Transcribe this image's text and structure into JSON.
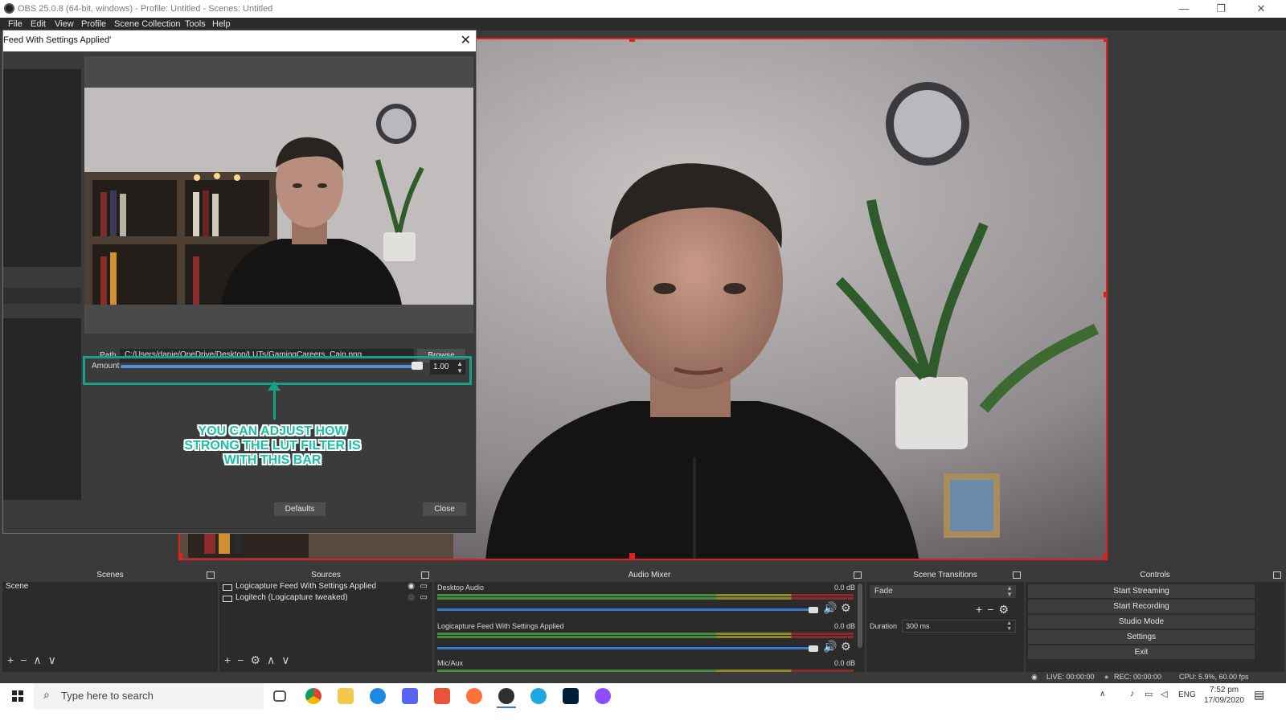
{
  "window": {
    "title": "OBS 25.0.8 (64-bit, windows) - Profile: Untitled - Scenes: Untitled",
    "controls": [
      "—",
      "❐",
      "✕"
    ]
  },
  "menu": [
    "File",
    "Edit",
    "View",
    "Profile",
    "Scene Collection",
    "Tools",
    "Help"
  ],
  "dialog": {
    "title": "Feed With Settings Applied'",
    "close_glyph": "✕",
    "path_label": "Path",
    "path_value": "C:/Users/danie/OneDrive/Desktop/LUTs/GamingCareers_Cain.png",
    "browse_label": "Browse",
    "amount_label": "Amount",
    "amount_value": "1.00",
    "amount_fraction": 1.0,
    "callout": "YOU CAN ADJUST HOW STRONG THE LUT FILTER IS WITH THIS BAR",
    "defaults_label": "Defaults",
    "close_label": "Close"
  },
  "docks": {
    "scenes": {
      "title": "Scenes",
      "items": [
        "Scene"
      ]
    },
    "sources": {
      "title": "Sources",
      "items": [
        "Logicapture Feed With Settings Applied",
        "Logitech (Logicapture tweaked)"
      ]
    },
    "mixer": {
      "title": "Audio Mixer",
      "tracks": [
        {
          "name": "Desktop Audio",
          "db": "0.0 dB"
        },
        {
          "name": "Logicapture Feed With Settings Applied",
          "db": "0.0 dB"
        },
        {
          "name": "Mic/Aux",
          "db": "0.0 dB"
        }
      ],
      "scale": [
        "-60",
        "-55",
        "-50",
        "-45",
        "-40",
        "-35",
        "-30",
        "-25",
        "-20",
        "-15",
        "-10",
        "-5",
        "0"
      ]
    },
    "transitions": {
      "title": "Scene Transitions",
      "selected": "Fade",
      "duration_label": "Duration",
      "duration_value": "300 ms"
    },
    "controls": {
      "title": "Controls",
      "buttons": [
        "Start Streaming",
        "Start Recording",
        "Studio Mode",
        "Settings",
        "Exit"
      ]
    }
  },
  "status": {
    "live": "LIVE: 00:00:00",
    "rec": "REC: 00:00:00",
    "cpu": "CPU: 5.9%, 60.00 fps"
  },
  "taskbar": {
    "search_placeholder": "Type here to search",
    "language": "ENG",
    "time": "7:52 pm",
    "date": "17/09/2020"
  },
  "colors": {
    "selection_red": "#e01f1f",
    "callout_teal": "#16a085",
    "obs_dark": "#2b2b2b",
    "obs_mid": "#3a3a3a",
    "slider_blue": "#3b78d0"
  }
}
